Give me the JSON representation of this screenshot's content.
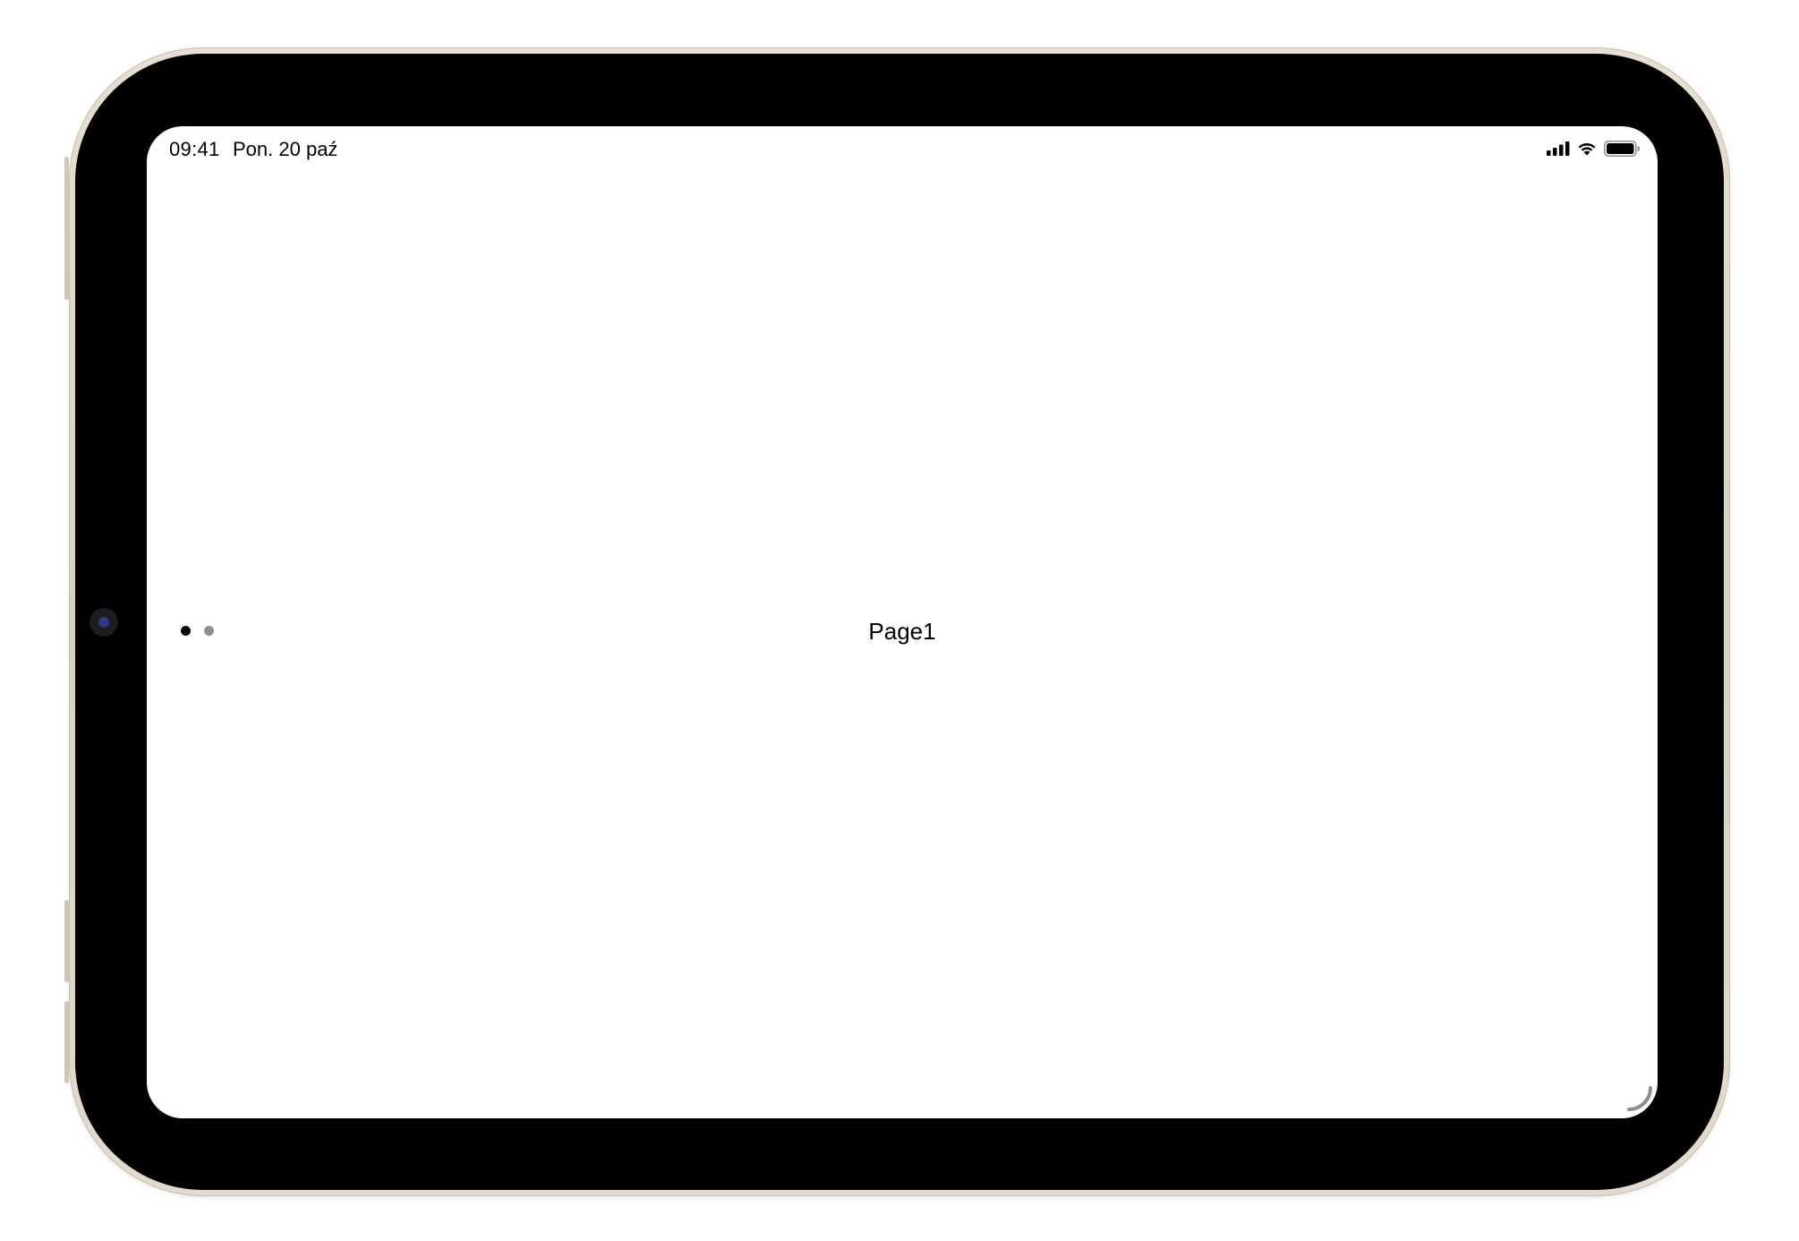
{
  "status_bar": {
    "time": "09:41",
    "date": "Pon. 20 paź",
    "icons": [
      "cellular-signal-icon",
      "wifi-icon",
      "battery-icon"
    ]
  },
  "pager": {
    "dots": [
      {
        "state": "active",
        "color": "#000000"
      },
      {
        "state": "inactive",
        "color": "#8e8e93"
      }
    ]
  },
  "content": {
    "label": "Page1"
  },
  "colors": {
    "frame": "#e0d9cc",
    "bezel": "#000000",
    "screen": "#ffffff"
  }
}
